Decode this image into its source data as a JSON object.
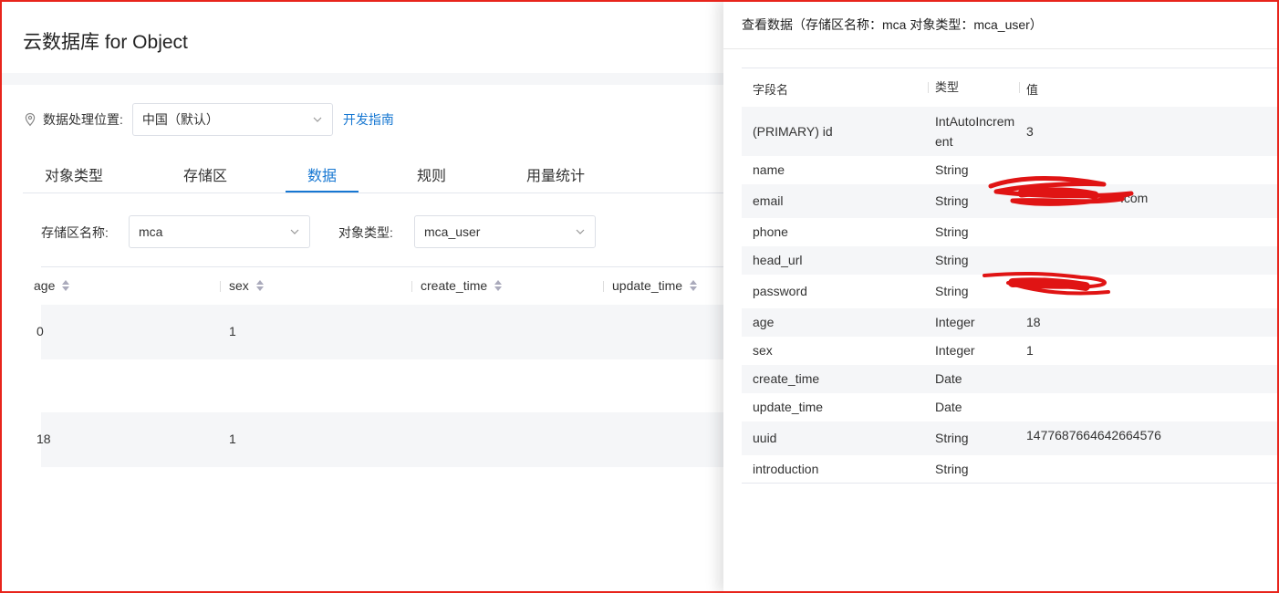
{
  "app": {
    "title": "云数据库 for Object"
  },
  "location": {
    "label": "数据处理位置:",
    "selected": "中国（默认）",
    "guide_link": "开发指南"
  },
  "tabs": [
    {
      "label": "对象类型",
      "active": false
    },
    {
      "label": "存储区",
      "active": false
    },
    {
      "label": "数据",
      "active": true
    },
    {
      "label": "规则",
      "active": false
    },
    {
      "label": "用量统计",
      "active": false
    }
  ],
  "filters": {
    "zone_label": "存储区名称:",
    "zone_value": "mca",
    "type_label": "对象类型:",
    "type_value": "mca_user"
  },
  "grid": {
    "columns": [
      "age",
      "sex",
      "create_time",
      "update_time"
    ],
    "rows": [
      {
        "age": "0",
        "sex": "1",
        "create_time": "",
        "update_time": ""
      },
      {
        "age": "",
        "sex": "",
        "create_time": "",
        "update_time": ""
      },
      {
        "age": "18",
        "sex": "1",
        "create_time": "",
        "update_time": ""
      }
    ]
  },
  "drawer": {
    "title": "查看数据（存储区名称：mca 对象类型：mca_user）",
    "headers": {
      "field": "字段名",
      "type": "类型",
      "value": "值"
    },
    "rows": [
      {
        "field": "(PRIMARY) id",
        "type": "IntAutoIncrement",
        "value": "3"
      },
      {
        "field": "name",
        "type": "String",
        "value": ""
      },
      {
        "field": "email",
        "type": "String",
        "value": ".com"
      },
      {
        "field": "phone",
        "type": "String",
        "value": ""
      },
      {
        "field": "head_url",
        "type": "String",
        "value": ""
      },
      {
        "field": "password",
        "type": "String",
        "value": ""
      },
      {
        "field": "age",
        "type": "Integer",
        "value": "18"
      },
      {
        "field": "sex",
        "type": "Integer",
        "value": "1"
      },
      {
        "field": "create_time",
        "type": "Date",
        "value": ""
      },
      {
        "field": "update_time",
        "type": "Date",
        "value": ""
      },
      {
        "field": "uuid",
        "type": "String",
        "value": "1477687664642664576"
      },
      {
        "field": "introduction",
        "type": "String",
        "value": ""
      }
    ]
  },
  "icons": {
    "location": "map-pin-icon",
    "dropdown": "chevron-down-icon",
    "sort": "sort-caret-icon"
  },
  "colors": {
    "accent": "#1677d2",
    "frame": "#e8251c",
    "redaction": "#e01414",
    "shaded_row": "#f5f6f8"
  }
}
